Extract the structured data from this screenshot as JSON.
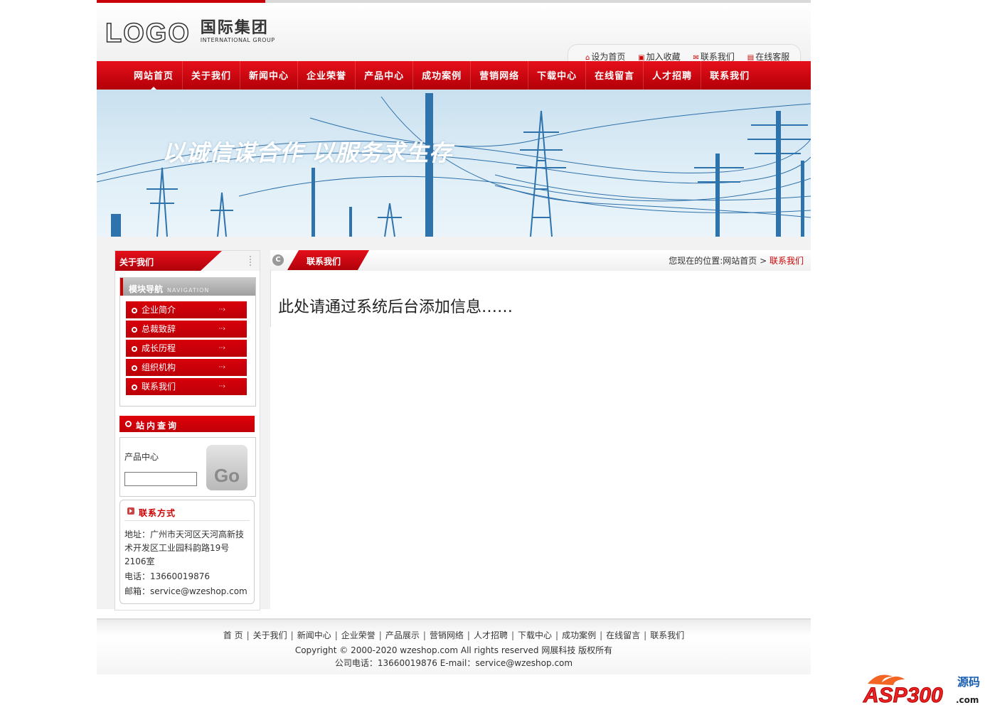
{
  "logo": {
    "mark": "LOGO",
    "cn": "国际集团",
    "en": "INTERNATIONAL GROUP"
  },
  "quick_links": [
    {
      "label": "设为首页",
      "icon": "home-icon"
    },
    {
      "label": "加入收藏",
      "icon": "favorite-icon"
    },
    {
      "label": "联系我们",
      "icon": "contact-icon"
    },
    {
      "label": "在线客服",
      "icon": "service-icon"
    }
  ],
  "nav": [
    "网站首页",
    "关于我们",
    "新闻中心",
    "企业荣誉",
    "产品中心",
    "成功案例",
    "营销网络",
    "下载中心",
    "在线留言",
    "人才招聘",
    "联系我们"
  ],
  "banner": {
    "slogan": "以诚信谋合作 以服务求生存"
  },
  "sidebar": {
    "title": "关于我们",
    "module_nav": {
      "cn": "模块导航",
      "en": "NAVIGATION"
    },
    "items": [
      "企业简介",
      "总裁致辞",
      "成长历程",
      "组织机构",
      "联系我们"
    ],
    "search": {
      "title": "站内查询",
      "label": "产品中心",
      "go": "Go"
    },
    "contact": {
      "title": "联系方式",
      "address": "地址：广州市天河区天河高新技术开发区工业园科韵路19号2106室",
      "phone": "电话：13660019876",
      "email": "邮箱：service@wzeshop.com"
    }
  },
  "content": {
    "chip": "C",
    "title": "联系我们",
    "breadcrumb": {
      "prefix": "您现在的位置:",
      "home": "网站首页",
      "sep": ">",
      "current": "联系我们"
    },
    "body": "此处请通过系统后台添加信息……"
  },
  "footer": {
    "links": [
      "首 页",
      "关于我们",
      "新闻中心",
      "企业荣誉",
      "产品展示",
      "营销网络",
      "人才招聘",
      "下载中心",
      "成功案例",
      "在线留言",
      "联系我们"
    ],
    "copyright": "Copyright © 2000-2020 wzeshop.com All rights reserved 网展科技 版权所有",
    "tel": "公司电话：13660019876 E-mail：service@wzeshop.com"
  },
  "watermark": {
    "brand": "ASP300",
    "cn": "源码",
    "com": ".com"
  }
}
